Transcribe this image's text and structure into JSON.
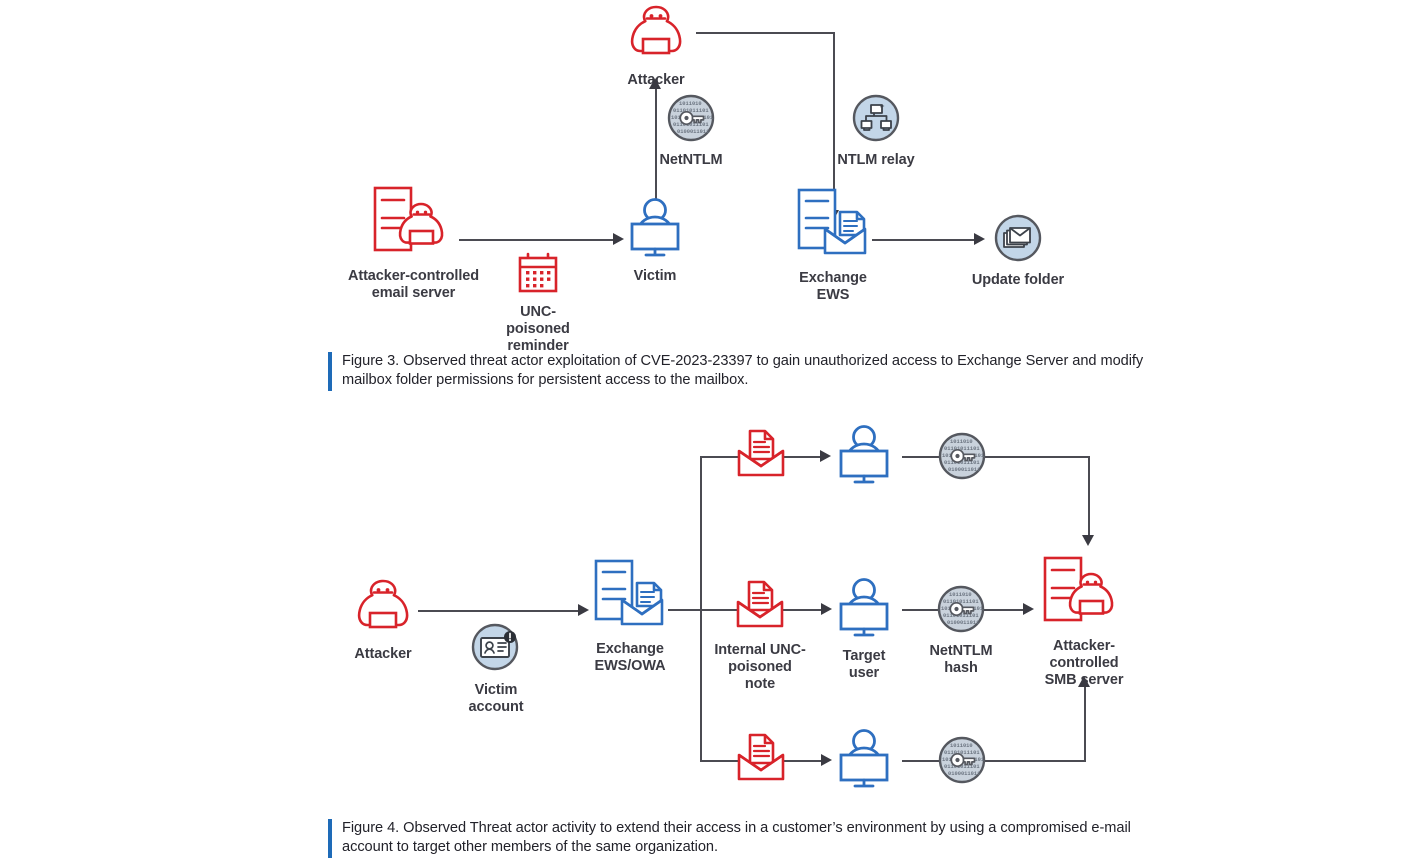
{
  "figure3": {
    "nodes": {
      "attacker": {
        "label": "Attacker",
        "icon": "attacker-hood-icon",
        "color": "#D8232A"
      },
      "netntlm": {
        "label": "NetNTLM",
        "icon": "binary-key-circle-icon",
        "color": "#9aa3ad"
      },
      "ntlm_relay": {
        "label": "NTLM relay",
        "icon": "network-relay-circle-icon",
        "color": "#b9cfe4"
      },
      "email_server": {
        "label": "Attacker-controlled\nemail server",
        "icon": "attacker-server-icon",
        "color": "#D8232A"
      },
      "reminder": {
        "label": "UNC-poisoned\nreminder",
        "icon": "calendar-icon",
        "color": "#D8232A"
      },
      "victim": {
        "label": "Victim",
        "icon": "user-monitor-icon",
        "color": "#2E6FC0"
      },
      "exchange_ews": {
        "label": "Exchange EWS",
        "icon": "server-mail-icon",
        "color": "#2E6FC0"
      },
      "update_folder": {
        "label": "Update folder",
        "icon": "mail-stack-circle-icon",
        "color": "#b9cfe4"
      }
    },
    "caption": "Figure 3. Observed threat actor exploitation of CVE-2023-23397 to gain unauthorized access to Exchange Server and modify mailbox folder permissions for persistent access to the mailbox."
  },
  "figure4": {
    "nodes": {
      "attacker": {
        "label": "Attacker",
        "icon": "attacker-hood-icon",
        "color": "#D8232A"
      },
      "victim_account": {
        "label": "Victim account",
        "icon": "id-badge-alert-circle-icon",
        "color": "#b9cfe4"
      },
      "exchange_ews_owa": {
        "label": "Exchange EWS/OWA",
        "icon": "server-mail-icon",
        "color": "#2E6FC0"
      },
      "note_top": {
        "label": "",
        "icon": "poisoned-note-icon",
        "color": "#D8232A"
      },
      "note_middle": {
        "label": "Internal UNC-\npoisoned note",
        "icon": "poisoned-note-icon",
        "color": "#D8232A"
      },
      "note_bottom": {
        "label": "",
        "icon": "poisoned-note-icon",
        "color": "#D8232A"
      },
      "user_top": {
        "label": "",
        "icon": "user-monitor-icon",
        "color": "#2E6FC0"
      },
      "user_middle": {
        "label": "Target user",
        "icon": "user-monitor-icon",
        "color": "#2E6FC0"
      },
      "user_bottom": {
        "label": "",
        "icon": "user-monitor-icon",
        "color": "#2E6FC0"
      },
      "hash_top": {
        "label": "",
        "icon": "binary-key-circle-icon",
        "color": "#9aa3ad"
      },
      "hash_middle": {
        "label": "NetNTLM hash",
        "icon": "binary-key-circle-icon",
        "color": "#9aa3ad"
      },
      "hash_bottom": {
        "label": "",
        "icon": "binary-key-circle-icon",
        "color": "#9aa3ad"
      },
      "smb_server": {
        "label": "Attacker-controlled\nSMB server",
        "icon": "attacker-server-icon",
        "color": "#D8232A"
      }
    },
    "caption": "Figure 4. Observed Threat actor activity to extend their access in a customer’s environment by using a compromised e-mail account to target other members of the same organization."
  },
  "colors": {
    "red": "#D8232A",
    "blue": "#2E6FC0",
    "line": "#4b4b52",
    "caption_bar": "#1e6bb8",
    "label_text": "#3b3b43",
    "circle_gray": "#9aa3ad",
    "circle_blue": "#c3d6e8"
  }
}
